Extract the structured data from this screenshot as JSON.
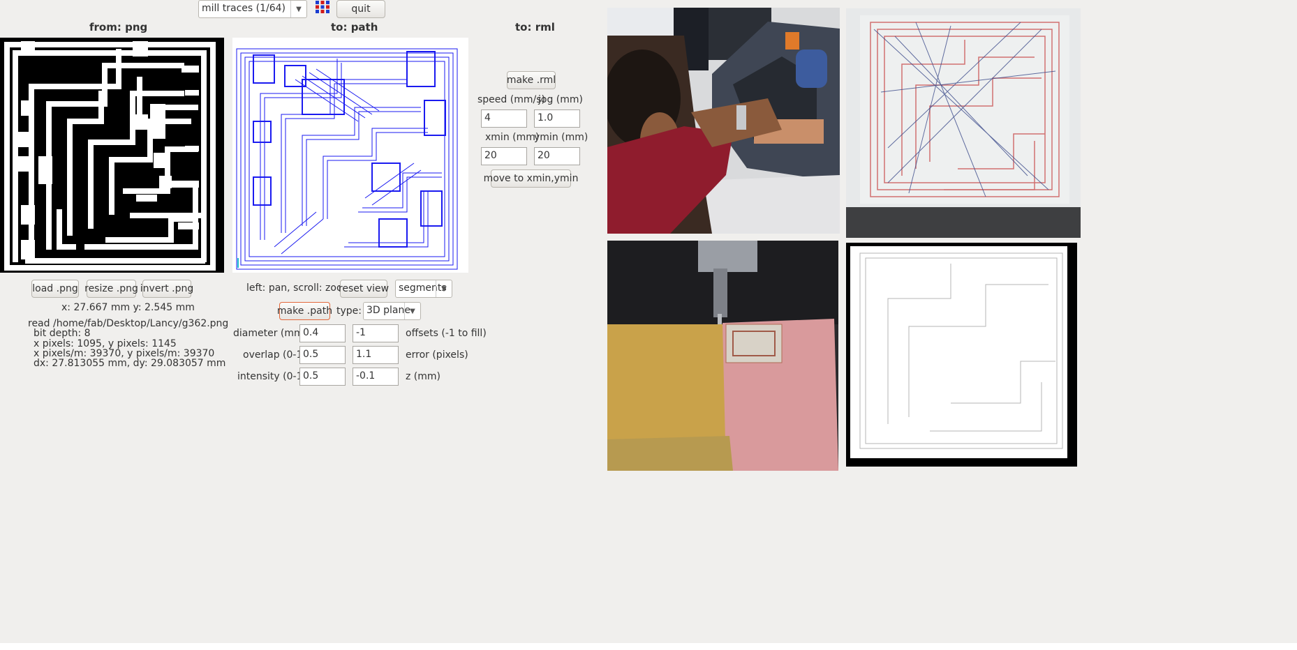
{
  "toolbar": {
    "process_select": "mill traces (1/64)",
    "quit_label": "quit"
  },
  "headers": {
    "from": "from: png",
    "to_path": "to: path",
    "to_rml": "to: rml"
  },
  "png_panel": {
    "load_label": "load .png",
    "resize_label": "resize .png",
    "invert_label": "invert .png",
    "coords": "x: 27.667 mm  y: 2.545 mm",
    "info": [
      "read /home/fab/Desktop/Lancy/g362.png",
      "bit depth: 8",
      "x pixels: 1095, y pixels: 1145",
      "x pixels/m: 39370, y pixels/m: 39370",
      "dx: 27.813055 mm, dy: 29.083057 mm"
    ]
  },
  "path_panel": {
    "pan_hint": "left: pan, scroll: zoom",
    "reset_view_label": "reset view",
    "view_mode_select": "segments",
    "make_path_label": "make .path",
    "type_label": "type:",
    "type_select": "3D plane",
    "diameter_label": "diameter (mm)",
    "diameter_value": "0.4",
    "offsets_value": "-1",
    "offsets_label": "offsets (-1 to fill)",
    "overlap_label": "overlap (0-1)",
    "overlap_value": "0.5",
    "error_value": "1.1",
    "error_label": "error (pixels)",
    "intensity_label": "intensity (0-1)",
    "intensity_value": "0.5",
    "z_value": "-0.1",
    "z_label": "z (mm)"
  },
  "rml_panel": {
    "make_rml_label": "make .rml",
    "speed_label": "speed (mm/s)",
    "jog_label": "jog (mm)",
    "speed_value": "4",
    "jog_value": "1.0",
    "xmin_label": "xmin (mm)",
    "ymin_label": "ymin (mm)",
    "xmin_value": "20",
    "ymin_value": "20",
    "move_label": "move to xmin,ymin"
  },
  "icons": {
    "app_logo": "fab-grid-icon",
    "dropdown": "chevron-down-icon"
  },
  "colors": {
    "background": "#f0efed",
    "path_blue": "#1a1af0",
    "highlight_border": "#e2673a"
  }
}
